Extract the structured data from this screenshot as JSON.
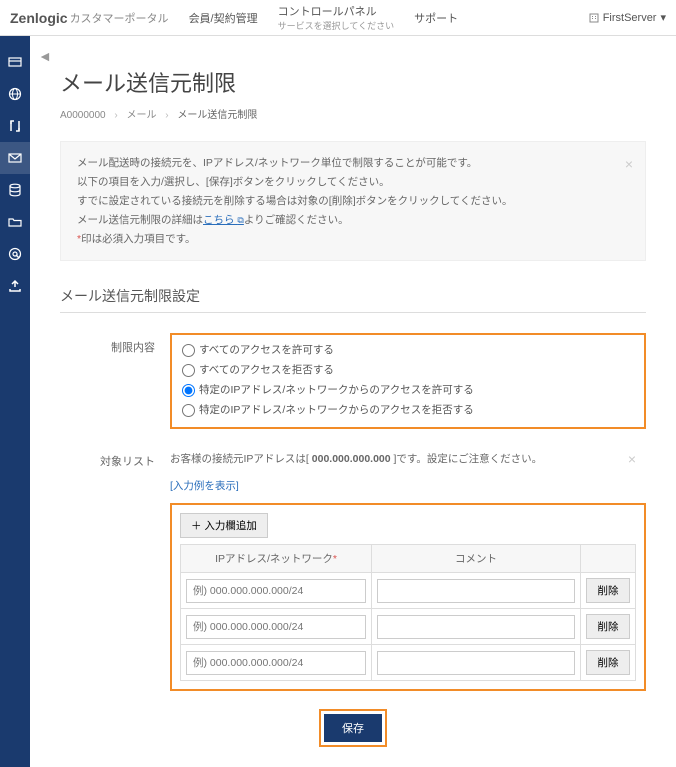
{
  "header": {
    "logo": "Zenlogic",
    "logo_sub": "カスタマーポータル",
    "nav1": "会員/契約管理",
    "nav2": "コントロールパネル",
    "nav2_sub": "サービスを選択してください",
    "nav3": "サポート",
    "user": "FirstServer"
  },
  "breadcrumb": {
    "item1": "A0000000",
    "item2": "メール",
    "item3": "メール送信元制限"
  },
  "page_title": "メール送信元制限",
  "info": {
    "line1": "メール配送時の接続元を、IPアドレス/ネットワーク単位で制限することが可能です。",
    "line2": "以下の項目を入力/選択し、[保存]ボタンをクリックしてください。",
    "line3": "すでに設定されている接続元を削除する場合は対象の[削除]ボタンをクリックしてください。",
    "line4a": "メール送信元制限の詳細は",
    "line4_link": "こちら",
    "line4b": "よりご確認ください。",
    "line5a": "*",
    "line5b": "印は必須入力項目です。"
  },
  "section_title": "メール送信元制限設定",
  "settings": {
    "label_restriction": "制限内容",
    "label_target": "対象リスト",
    "radio1": "すべてのアクセスを許可する",
    "radio2": "すべてのアクセスを拒否する",
    "radio3": "特定のIPアドレス/ネットワークからのアクセスを許可する",
    "radio4": "特定のIPアドレス/ネットワークからのアクセスを拒否する"
  },
  "target": {
    "note_a": "お客様の接続元IPアドレスは[ ",
    "note_ip": "000.000.000.000",
    "note_b": " ]です。設定にご注意ください。",
    "example": "[入力例を表示]",
    "add_btn": "＋ 入力欄追加",
    "col_ip": "IPアドレス/ネットワーク",
    "col_comment": "コメント",
    "placeholder": "例) 000.000.000.000/24",
    "del": "削除"
  },
  "save": "保存"
}
